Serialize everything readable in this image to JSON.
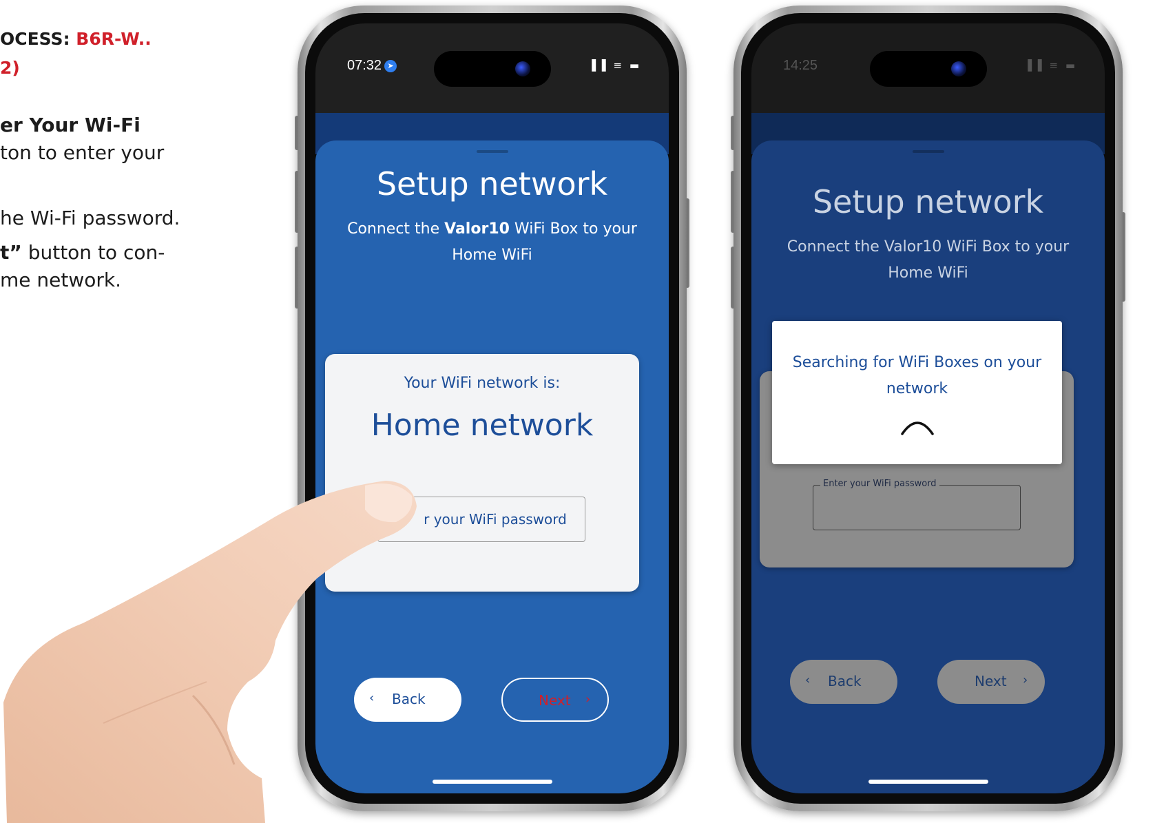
{
  "instructions": {
    "heading_prefix": "OCESS: ",
    "heading_code": "B6R-W..",
    "heading_part": "2)",
    "step_title": "er Your Wi-Fi",
    "line1": "ton to enter your",
    "line2": "he Wi-Fi password.",
    "line3_bold": "t”",
    "line3_rest": " button to con-",
    "line4": "me network."
  },
  "phone1": {
    "time": "07:32",
    "status_icons": "▐▐ ≡ ▬",
    "title": "Setup network",
    "subtitle_pre": "Connect the ",
    "subtitle_brand": "Valor10",
    "subtitle_post": " WiFi Box to your",
    "subtitle_line2": "Home WiFi",
    "network_label": "Your WiFi network is:",
    "network_name": "Home network",
    "password_placeholder": "r your WiFi password",
    "back_label": "Back",
    "next_label": "Next",
    "back_chevron": "‹",
    "next_chevron": "›"
  },
  "phone2": {
    "time": "14:25",
    "status_icons": "▐▐ ≡ ▬",
    "title": "Setup network",
    "subtitle_pre": "Connect the ",
    "subtitle_brand": "Valor10",
    "subtitle_post": " WiFi Box to your",
    "subtitle_line2": "Home WiFi",
    "modal_line1": "Searching for WiFi Boxes on your",
    "modal_line2": "network",
    "password_legend": "Enter your WiFi password",
    "back_label": "Back",
    "next_label": "Next",
    "back_chevron": "‹",
    "next_chevron": "›"
  },
  "colors": {
    "brand_red": "#d0202a",
    "sheet_blue": "#2563b0",
    "dim_blue": "#1a3f7d",
    "text_blue": "#1d4e99"
  }
}
